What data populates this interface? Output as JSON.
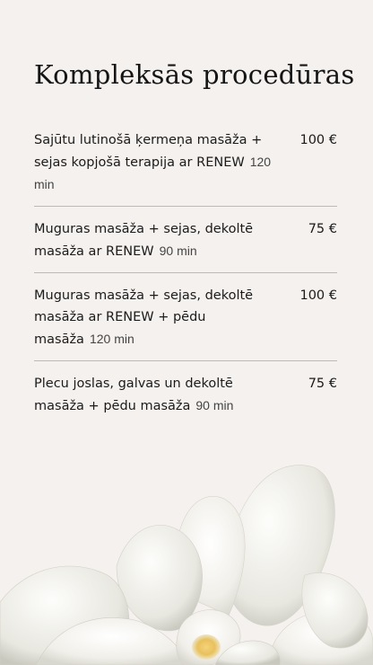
{
  "page": {
    "title": "Kompleksās procedūras"
  },
  "items": [
    {
      "name": "Sajūtu lutinošā ķermeņa masāža + sejas kopjošā terapija ar RENEW",
      "duration": "120 min",
      "price": "100 €"
    },
    {
      "name": "Muguras masāža + sejas, dekoltē masāža ar RENEW",
      "duration": "90 min",
      "price": "75 €"
    },
    {
      "name": "Muguras masāža + sejas, dekoltē masāža ar RENEW + pēdu masāža",
      "duration": "120 min",
      "price": "100 €"
    },
    {
      "name": "Plecu joslas, galvas un dekoltē masāža + pēdu masāža",
      "duration": "90 min",
      "price": "75 €"
    }
  ],
  "colors": {
    "background": "#f5f1ee",
    "divider": "#d8b878",
    "text": "#1b1b1b"
  },
  "decoration": {
    "image": "white-orchid-flower"
  }
}
